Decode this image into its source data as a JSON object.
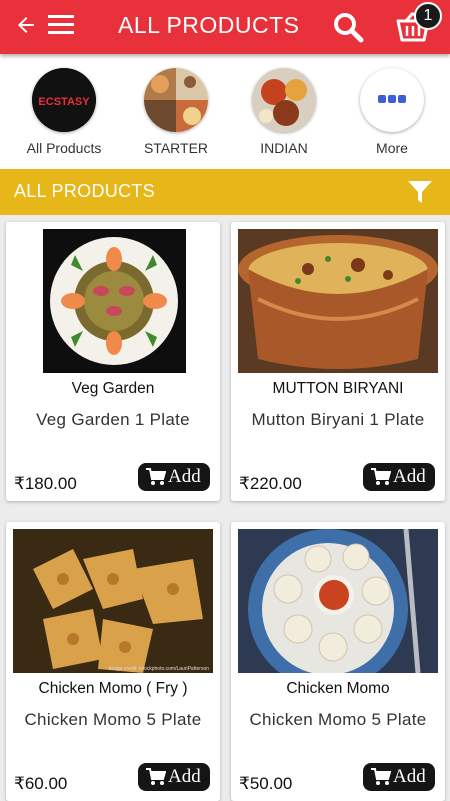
{
  "header": {
    "title": "ALL PRODUCTS",
    "cart_count": "1",
    "icons": [
      "back-arrow-icon",
      "hamburger-menu-icon",
      "search-icon",
      "cart-icon"
    ],
    "background_color": "#e8313b"
  },
  "categories": [
    {
      "label": "All Products",
      "logo_text": "ECSTASY"
    },
    {
      "label": "STARTER"
    },
    {
      "label": "INDIAN"
    },
    {
      "label": "More"
    }
  ],
  "section": {
    "title": "ALL PRODUCTS",
    "icon": "filter-icon",
    "background_color": "#e7b619"
  },
  "products": [
    {
      "name": "Veg Garden",
      "desc": "Veg Garden 1 Plate",
      "price": "₹180.00",
      "add_label": "Add"
    },
    {
      "name": "MUTTON BIRYANI",
      "desc": "Mutton Biryani 1 Plate",
      "price": "₹220.00",
      "add_label": "Add"
    },
    {
      "name": "Chicken Momo ( Fry )",
      "desc": "Chicken Momo 5 Plate",
      "price": "₹60.00",
      "add_label": "Add",
      "image_credit": "Image credit: istockphoto.com/LauriPatterson"
    },
    {
      "name": "Chicken Momo",
      "desc": "Chicken Momo 5 Plate",
      "price": "₹50.00",
      "add_label": "Add"
    }
  ]
}
